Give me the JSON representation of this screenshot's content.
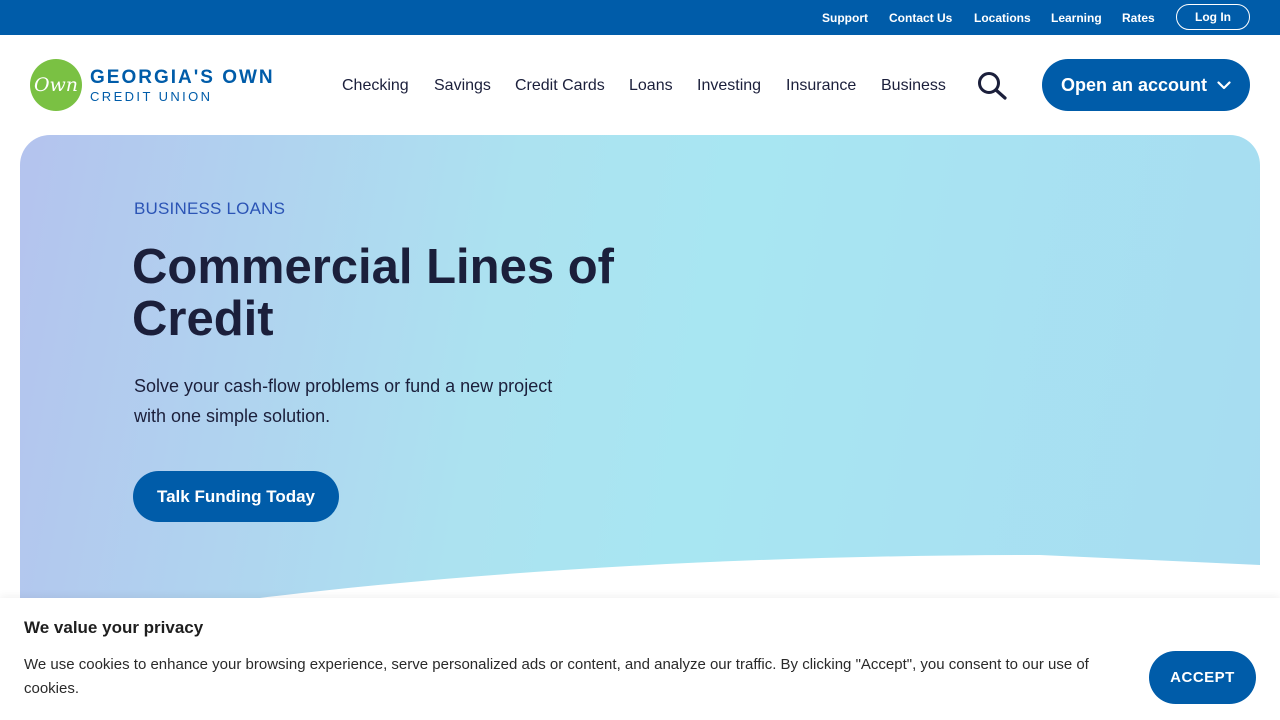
{
  "utility_nav": {
    "items": [
      {
        "label": "Support"
      },
      {
        "label": "Contact Us"
      },
      {
        "label": "Locations"
      },
      {
        "label": "Learning"
      },
      {
        "label": "Rates"
      }
    ],
    "login_label": "Log In"
  },
  "brand": {
    "logo_mark": "Own",
    "name": "GEORGIA'S OWN",
    "subname": "CREDIT UNION"
  },
  "main_nav": {
    "items": [
      {
        "label": "Checking"
      },
      {
        "label": "Savings"
      },
      {
        "label": "Credit Cards"
      },
      {
        "label": "Loans"
      },
      {
        "label": "Investing"
      },
      {
        "label": "Insurance"
      },
      {
        "label": "Business"
      }
    ],
    "search_icon": "search-icon",
    "open_account_label": "Open an account",
    "open_account_icon": "chevron-down-icon"
  },
  "hero": {
    "eyebrow": "BUSINESS LOANS",
    "title": "Commercial Lines of Credit",
    "description": "Solve your cash-flow problems or fund a new project with one simple solution.",
    "cta_label": "Talk Funding Today"
  },
  "cookie_banner": {
    "title": "We value your privacy",
    "text": "We use cookies to enhance your browsing experience, serve personalized ads or content, and analyze our traffic. By clicking \"Accept\", you consent to our use of cookies.",
    "accept_label": "ACCEPT"
  },
  "colors": {
    "brand_blue": "#005ca9",
    "logo_green": "#7ac143",
    "heading_navy": "#1b1f3b",
    "eyebrow_blue": "#2b54b5"
  }
}
